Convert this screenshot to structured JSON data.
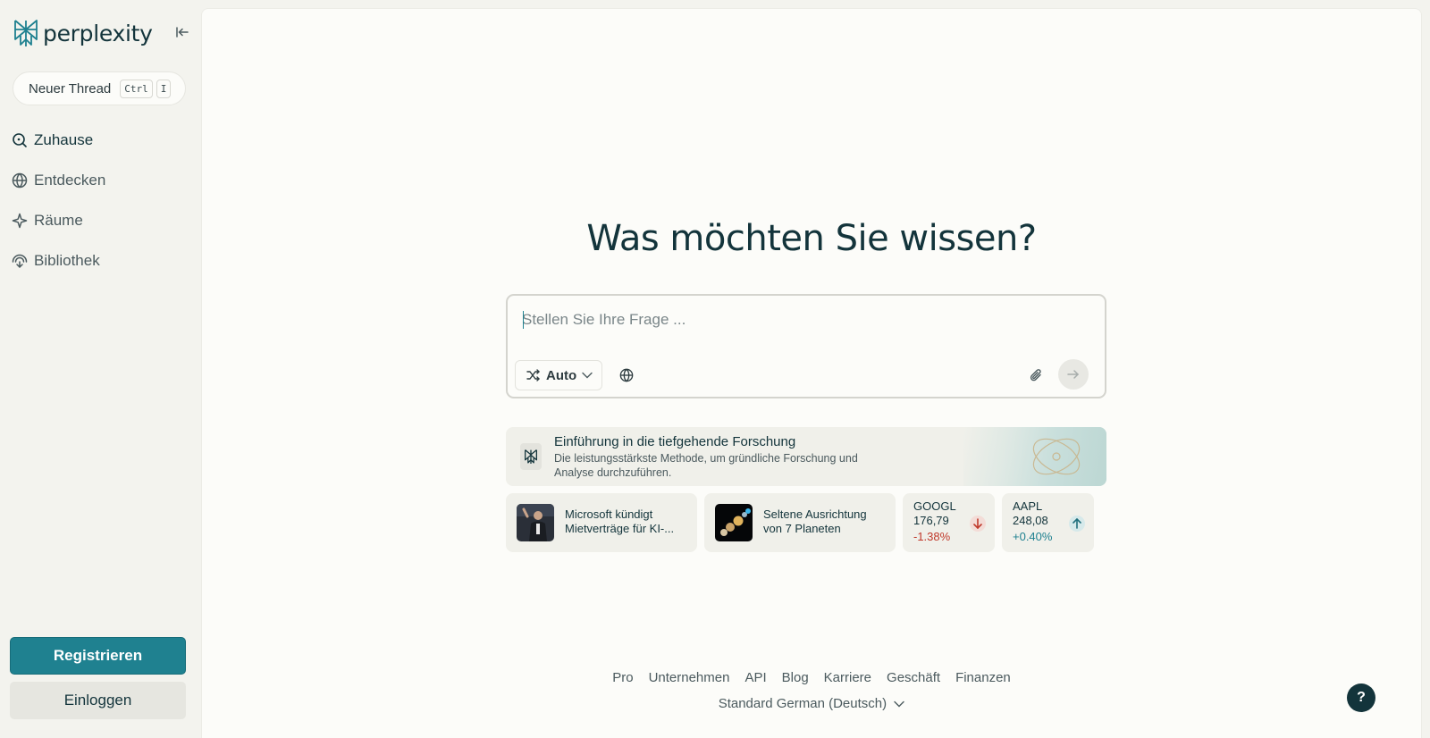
{
  "app": {
    "name": "perplexity"
  },
  "sidebar": {
    "new_thread": {
      "label": "Neuer Thread",
      "shortcut_keys": [
        "Ctrl",
        "I"
      ]
    },
    "nav": [
      {
        "label": "Zuhause",
        "icon": "search-icon",
        "active": true
      },
      {
        "label": "Entdecken",
        "icon": "globe-icon",
        "active": false
      },
      {
        "label": "Räume",
        "icon": "sparkle-icon",
        "active": false
      },
      {
        "label": "Bibliothek",
        "icon": "library-icon",
        "active": false
      }
    ],
    "register_label": "Registrieren",
    "login_label": "Einloggen"
  },
  "main": {
    "headline": "Was möchten Sie wissen?",
    "search": {
      "placeholder": "Stellen Sie Ihre Frage ...",
      "value": "",
      "mode_label": "Auto"
    },
    "promo": {
      "title": "Einführung in die tiefgehende Forschung",
      "description": "Die leistungsstärkste Methode, um gründliche Forschung und Analyse durchzuführen."
    },
    "news": [
      {
        "title": "Microsoft kündigt Mietverträge für KI-..."
      },
      {
        "title": "Seltene Ausrichtung von 7 Planeten"
      }
    ],
    "stocks": [
      {
        "symbol": "GOOGL",
        "price": "176,79",
        "change": "-1.38%",
        "direction": "down",
        "color": "#c0392b"
      },
      {
        "symbol": "AAPL",
        "price": "248,08",
        "change": "+0.40%",
        "direction": "up",
        "color": "#1f8190"
      }
    ]
  },
  "footer": {
    "links": [
      "Pro",
      "Unternehmen",
      "API",
      "Blog",
      "Karriere",
      "Geschäft",
      "Finanzen"
    ],
    "language": "Standard German (Deutsch)"
  },
  "help_label": "?",
  "colors": {
    "accent": "#1f8190",
    "text": "#13343b",
    "negative": "#c0392b"
  }
}
